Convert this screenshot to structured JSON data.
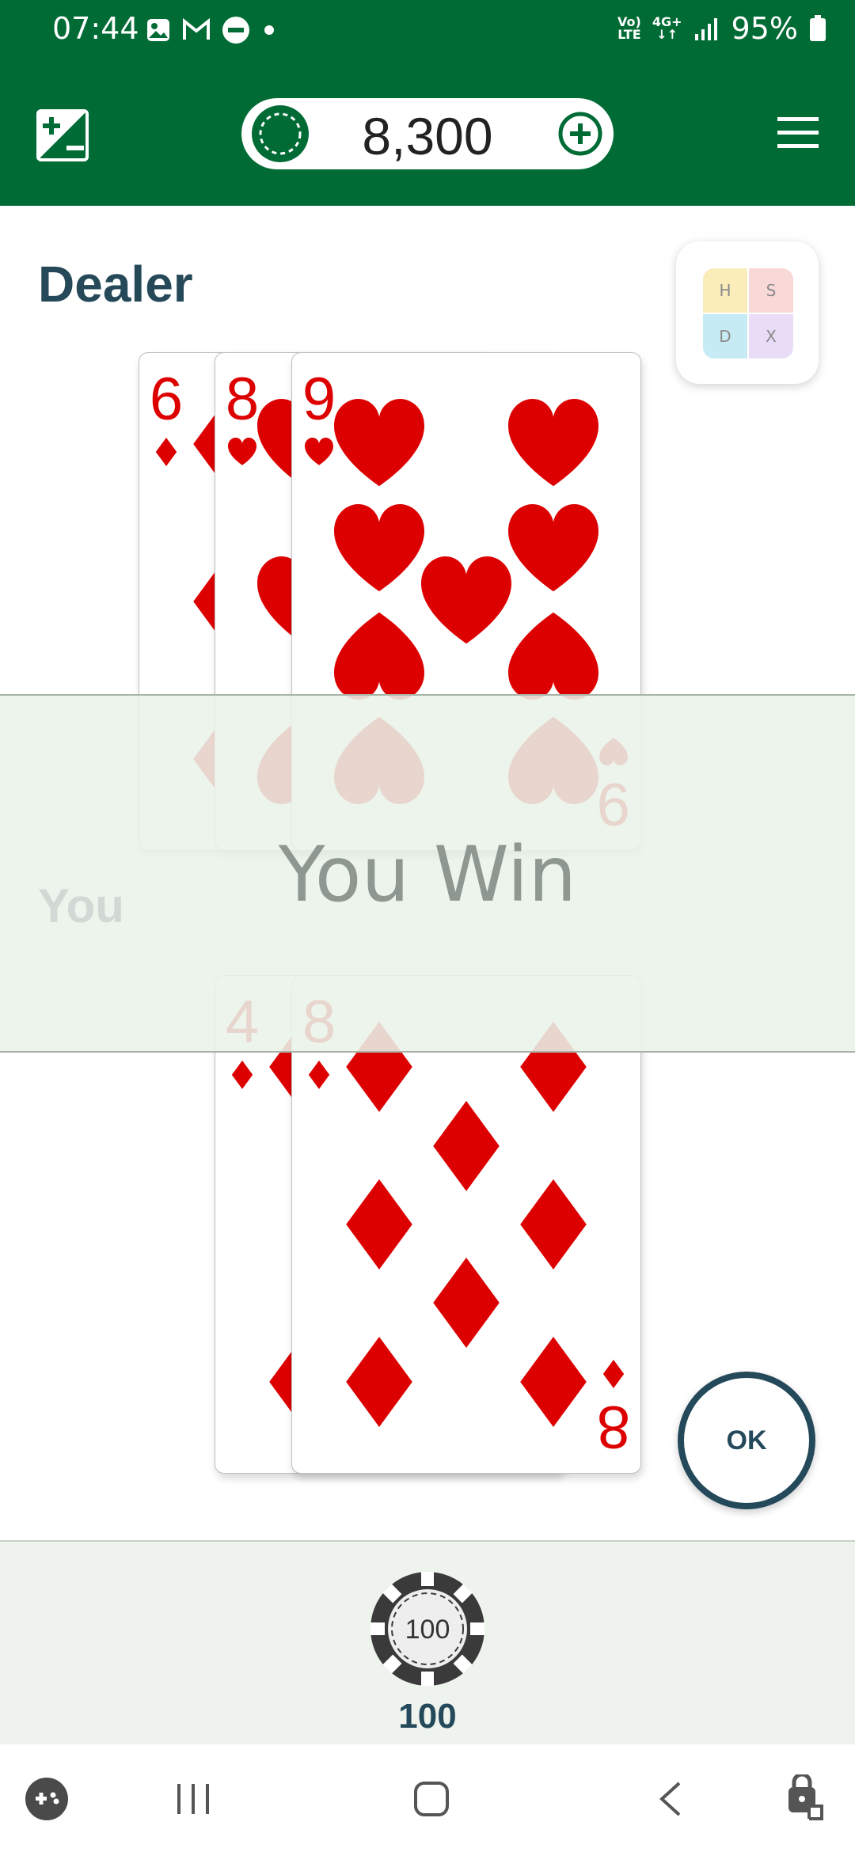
{
  "status_bar": {
    "time": "07:44",
    "network_top": "Vo)",
    "network_bottom": "LTE",
    "data_top": "4G+",
    "battery": "95%"
  },
  "header": {
    "balance": "8,300",
    "icons": [
      "exposure-icon",
      "chip-icon",
      "add-circle-icon",
      "hamburger-menu-icon"
    ]
  },
  "dealer": {
    "label": "Dealer",
    "cards": [
      {
        "rank": "6",
        "suit": "diamonds"
      },
      {
        "rank": "8",
        "suit": "hearts"
      },
      {
        "rank": "9",
        "suit": "hearts"
      }
    ]
  },
  "player": {
    "label": "You",
    "cards": [
      {
        "rank": "4",
        "suit": "diamonds"
      },
      {
        "rank": "8",
        "suit": "diamonds"
      }
    ]
  },
  "strategy_chart": {
    "cells": [
      "H",
      "S",
      "D",
      "X"
    ]
  },
  "result": {
    "message": "You Win"
  },
  "actions": {
    "ok_label": "OK"
  },
  "bet": {
    "chip_value": "100",
    "amount": "100"
  },
  "colors": {
    "app_green": "#006b35",
    "dark_teal": "#24495a",
    "card_red": "#dd0000"
  }
}
